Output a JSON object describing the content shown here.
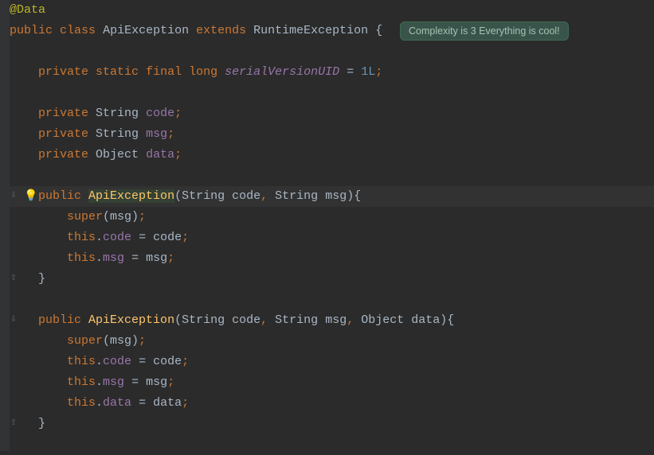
{
  "hint": {
    "text": "Complexity is 3 Everything is cool!"
  },
  "code": {
    "annotation": "@Data",
    "mods": {
      "public": "public",
      "class": "class",
      "extends": "extends",
      "private": "private",
      "static": "static",
      "final": "final",
      "long": "long",
      "this": "this",
      "super": "super"
    },
    "types": {
      "String": "String",
      "Object": "Object"
    },
    "classname": "ApiException",
    "superclass": "RuntimeException",
    "serialField": "serialVersionUID",
    "serialVal": "1L",
    "fields": {
      "code": "code",
      "msg": "msg",
      "data": "data"
    },
    "ctor": "ApiException",
    "params": {
      "code": "code",
      "msg": "msg",
      "data": "data"
    }
  },
  "icons": {
    "bulb": "💡",
    "override_down": "⇩",
    "override_up": "⇧"
  }
}
